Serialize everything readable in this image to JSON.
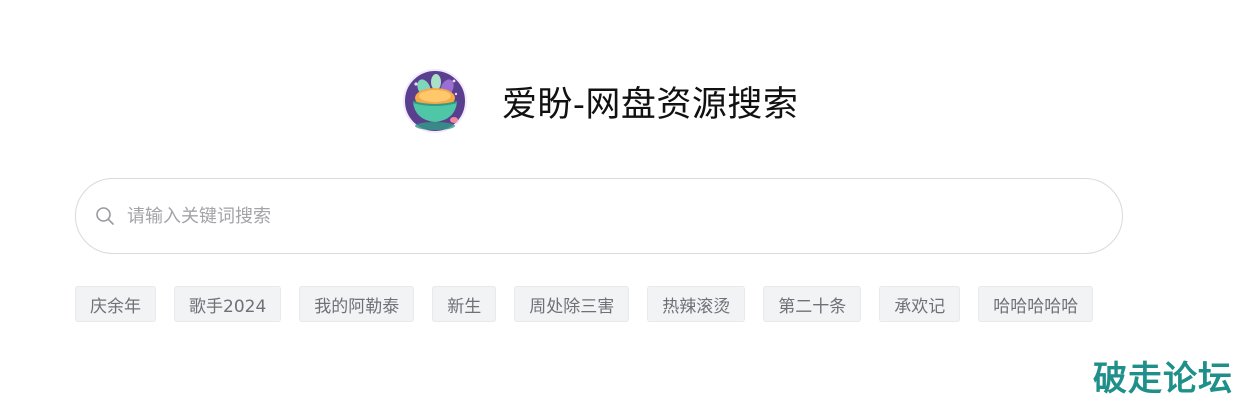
{
  "header": {
    "title": "爱盼-网盘资源搜索",
    "logo_icon": "bowl-logo-icon"
  },
  "search": {
    "placeholder": "请输入关键词搜索",
    "value": "",
    "icon": "search-icon"
  },
  "tags": [
    {
      "label": "庆余年"
    },
    {
      "label": "歌手2024"
    },
    {
      "label": "我的阿勒泰"
    },
    {
      "label": "新生"
    },
    {
      "label": "周处除三害"
    },
    {
      "label": "热辣滚烫"
    },
    {
      "label": "第二十条"
    },
    {
      "label": "承欢记"
    },
    {
      "label": "哈哈哈哈哈"
    }
  ],
  "watermark": {
    "text": "破走论坛",
    "color": "#1f8f8a"
  },
  "colors": {
    "search_border": "#d9d9de",
    "tag_background": "#f2f3f5",
    "tag_text": "#707078",
    "logo_purple": "#5b3f8f"
  }
}
